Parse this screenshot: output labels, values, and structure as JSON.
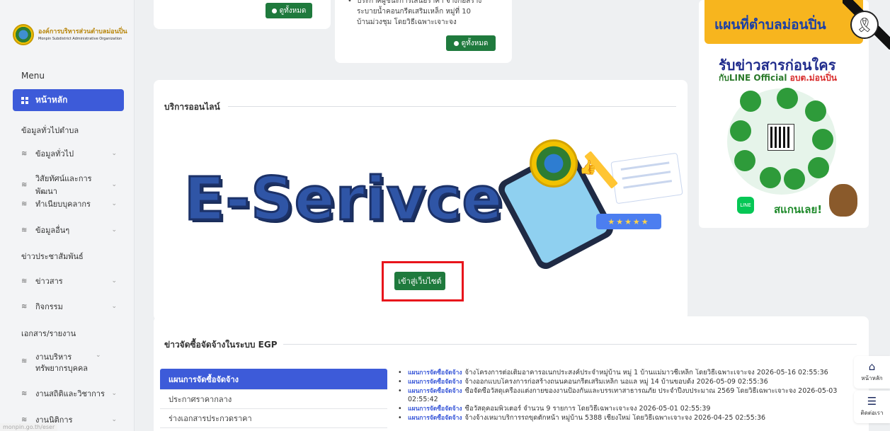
{
  "sidebar": {
    "logo": {
      "title": "องค์การบริหารส่วนตำบลม่อนปิ่น",
      "subtitle": "Monpin Subdistrict Administrative Organization"
    },
    "menu_title": "Menu",
    "home_label": "หน้าหลัก",
    "sections": [
      {
        "heading": "ข้อมูลทั่วไปตำบล",
        "items": [
          "ข้อมูลทั่วไป",
          "วิสัยทัศน์และการพัฒนา",
          "ทำเนียบบุคลากร",
          "ข้อมูลอื่นๆ"
        ]
      },
      {
        "heading": "ข่าวประชาสัมพันธ์",
        "items": [
          "ข่าวสาร",
          "กิจกรรม"
        ]
      },
      {
        "heading": "เอกสาร/รายงาน",
        "items": [
          "งานบริหารทรัพยากรบุคคล",
          "งานสถิติและวิชาการ",
          "งานนิติการ"
        ]
      }
    ]
  },
  "top": {
    "view_all_label": "ดูทั้งหมด",
    "news_lines": [
      "ประกาศผู้ชนะการเสนอราคา จ้างก่อสร้าง",
      "ระบายน้ำคอนกรีตเสริมเหล็ก หมู่ที่ 10",
      "บ้านม่วงชุม โดยวิธีเฉพาะเจาะจง"
    ]
  },
  "online": {
    "title": "บริการออนไลน์",
    "banner_text": "E-Serivce",
    "stars": "★★★★★",
    "enter_label": "เข้าสู่เว็บไซต์"
  },
  "egp": {
    "title": "ข่าวจัดซื้อจัดจ้างในระบบ EGP",
    "tabs": [
      "แผนการจัดซื้อจัดจ้าง",
      "ประกาศราคากลาง",
      "ร่างเอกสารประกวดราคา"
    ],
    "tag": "แผนการจัดซื้อจัดจ้าง",
    "items": [
      "จ้างโครงการต่อเติมอาคารอเนกประสงค์ประจำหมู่บ้าน หมู่ 1 บ้านแม่มาวชี้เหล็ก โดยวิธีเฉพาะเจาะจง 2026-05-16 02:55:36",
      "จ้างออกแบบโครงการก่อสร้างถนนคอนกรีตเสริมเหล็ก นอแล หมู่ 14 บ้านขอบด้ง 2026-05-09 02:55:36",
      "ซื้อจัดซื้อวัสดุเครื่องแต่งกายของงานป้องกันและบรรเทาสาธารณภัย ประจำปีงบประมาณ 2569 โดยวิธีเฉพาะเจาะจง 2026-05-03 02:55:42",
      "ซื้อวัสดุคอมพิวเตอร์ จำนวน 9 รายการ โดยวิธีเฉพาะเจาะจง 2026-05-01 02:55:39",
      "จ้างจ้างเหมาบริการรถขุดตักหน้า หมู่บ้าน 5388 เชียงใหม่ โดยวิธีเฉพาะเจาะจง 2026-04-25 02:55:36"
    ]
  },
  "poster": {
    "title": "แผนที่ตำบลม่อนปิ่น",
    "headline": "รับข่าวสารก่อนใคร",
    "sub_prefix": "กับLINE Official",
    "sub_highlight": "อบต.ม่อนปิ่น",
    "scan_label": "สแกนเลย!",
    "line_label": "LINE"
  },
  "floating": {
    "home_label": "หน้าหลัก",
    "contact_label": "ติดต่อเรา"
  },
  "status_url": "monpin.go.th/eser"
}
